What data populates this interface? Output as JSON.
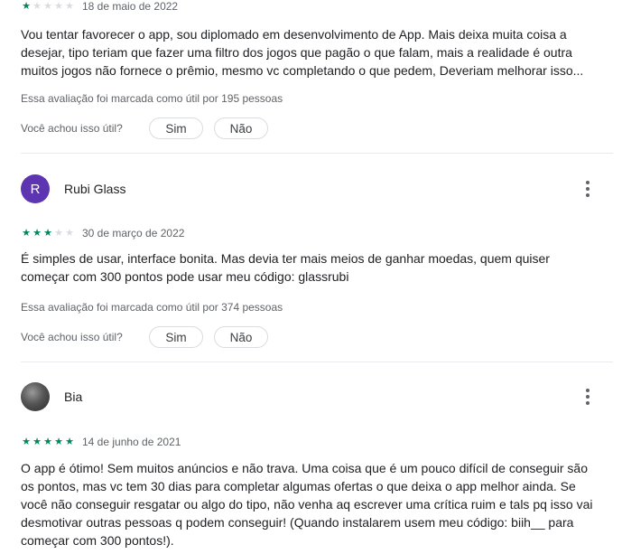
{
  "reviews": [
    {
      "rating": 1,
      "date": "18 de maio de 2022",
      "text": "Vou tentar favorecer o app, sou diplomado em desenvolvimento de App. Mais deixa muita coisa a desejar, tipo teriam que fazer uma filtro dos jogos que pagão o que falam, mais a realidade é outra muitos jogos não fornece o prêmio, mesmo vc completando o que pedem, Deveriam melhorar isso...",
      "helpful_count": "Essa avaliação foi marcada como útil por 195 pessoas"
    },
    {
      "author": "Rubi Glass",
      "avatar_letter": "R",
      "avatar_color": "#5e35b1",
      "rating": 3,
      "date": "30 de março de 2022",
      "text": "É simples de usar, interface bonita. Mas devia ter mais meios de ganhar moedas, quem quiser começar com 300 pontos pode usar meu código: glassrubi",
      "helpful_count": "Essa avaliação foi marcada como útil por 374 pessoas"
    },
    {
      "author": "Bia",
      "rating": 5,
      "date": "14 de junho de 2021",
      "text": "O app é ótimo! Sem muitos anúncios e não trava. Uma coisa que é um pouco difícil de conseguir são os pontos, mas vc tem 30 dias para completar algumas ofertas o que deixa o app melhor ainda. Se você não conseguir resgatar ou algo do tipo, não venha aq escrever uma crítica ruim e tals pq isso vai desmotivar outras pessoas q podem conseguir! (Quando instalarem usem meu código: biih__ para começar com 300 pontos!)."
    }
  ],
  "helpful": {
    "question": "Você achou isso útil?",
    "yes_label": "Sim",
    "no_label": "Não"
  },
  "colors": {
    "star_filled": "#01875f",
    "star_empty": "#dadce0",
    "avatar_purple": "#5e35b1"
  },
  "icons": {
    "more": "more-vert-icon",
    "star": "star-icon"
  }
}
